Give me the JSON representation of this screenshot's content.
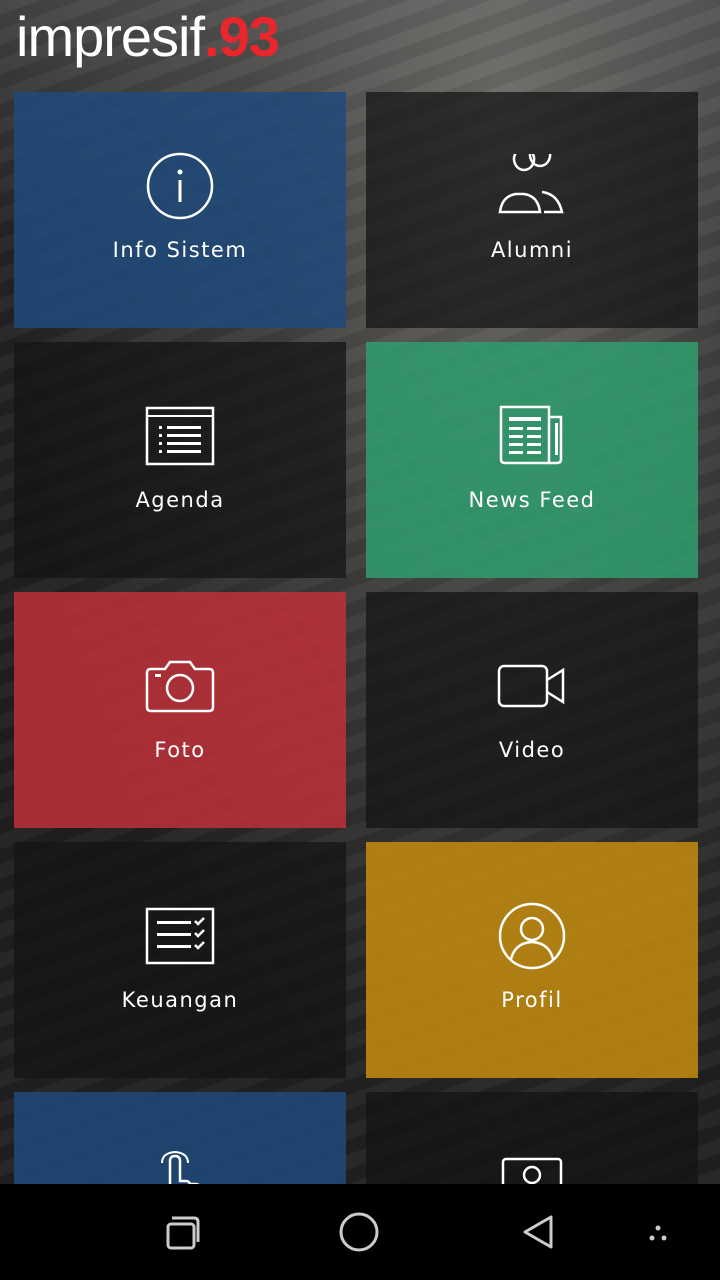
{
  "header": {
    "logo_main": "impresif",
    "logo_suffix": ".93"
  },
  "colors": {
    "blue": "#1f4a7a",
    "green": "#2f9e6e",
    "red": "#c0303a",
    "gold": "#c08a10",
    "dark": "#141414",
    "logo_accent": "#e8262b"
  },
  "tiles": [
    {
      "label": "Info Sistem",
      "icon": "info-icon"
    },
    {
      "label": "Alumni",
      "icon": "people-icon"
    },
    {
      "label": "Agenda",
      "icon": "list-icon"
    },
    {
      "label": "News Feed",
      "icon": "newspaper-icon"
    },
    {
      "label": "Foto",
      "icon": "camera-icon"
    },
    {
      "label": "Video",
      "icon": "video-camera-icon"
    },
    {
      "label": "Keuangan",
      "icon": "checklist-icon"
    },
    {
      "label": "Profil",
      "icon": "user-circle-icon"
    },
    {
      "label": "",
      "icon": "tap-hand-icon"
    },
    {
      "label": "",
      "icon": "id-card-icon"
    }
  ],
  "navbar": {
    "items": [
      "recent-apps-icon",
      "home-icon",
      "back-icon",
      "menu-dots-icon"
    ]
  }
}
